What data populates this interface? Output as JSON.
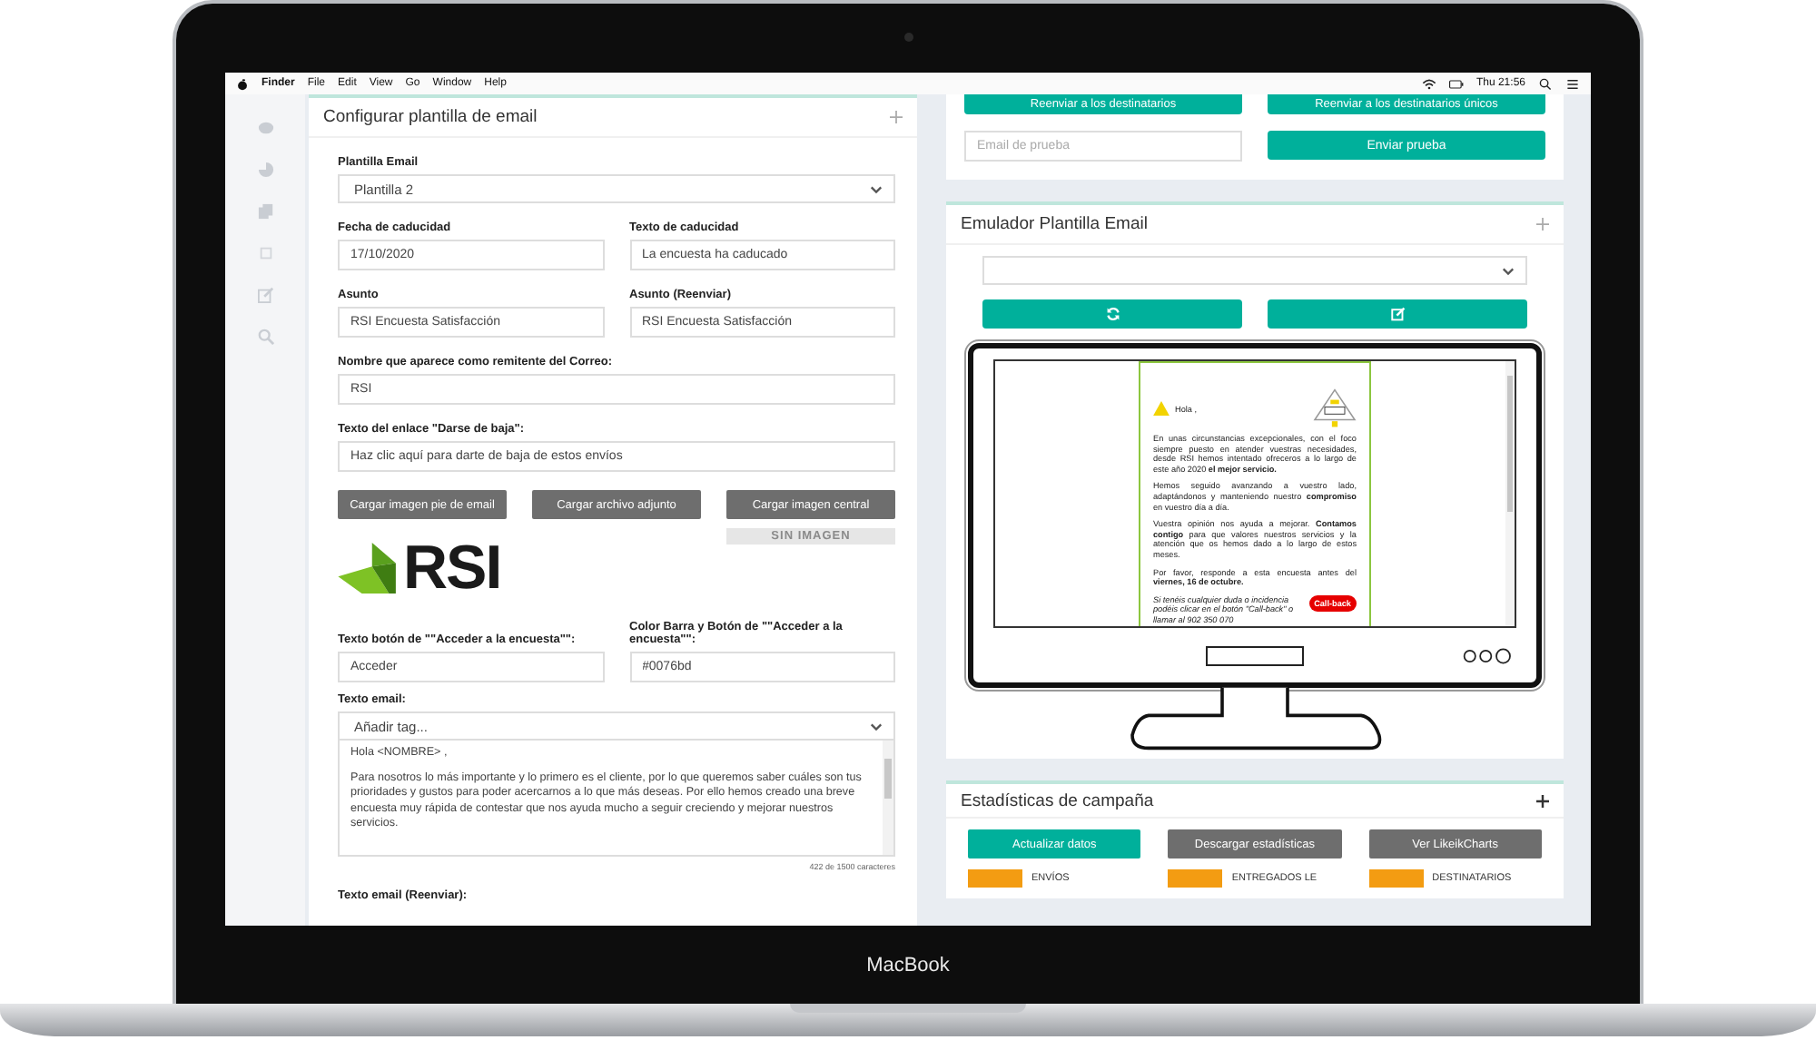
{
  "menu_bar": {
    "app": "Finder",
    "items": [
      "File",
      "Edit",
      "View",
      "Go",
      "Window",
      "Help"
    ],
    "clock": "Thu 21:56"
  },
  "config_panel": {
    "title": "Configurar plantilla de email",
    "template": {
      "label": "Plantilla Email",
      "value": "Plantilla 2"
    },
    "field_rows": [
      [
        {
          "label": "Fecha de caducidad",
          "value": "17/10/2020"
        },
        {
          "label": "Texto de caducidad",
          "value": "La encuesta ha caducado"
        }
      ],
      [
        {
          "label": "Asunto",
          "value": "RSI Encuesta Satisfacción"
        },
        {
          "label": "Asunto (Reenviar)",
          "value": "RSI Encuesta Satisfacción"
        }
      ],
      [
        {
          "label": "Nombre que aparece como remitente del Correo:",
          "value": "RSI"
        }
      ],
      [
        {
          "label": "Texto del enlace \"Darse de baja\":",
          "value": "Haz clic aquí para darte de baja de estos envíos"
        }
      ]
    ],
    "upload_buttons": [
      "Cargar imagen pie de email",
      "Cargar archivo adjunto",
      "Cargar imagen central"
    ],
    "no_image": "SIN IMAGEN",
    "logo_text": "RSI",
    "button_fields": [
      {
        "label": "Texto botón de \"\"Acceder a la encuesta\"\":",
        "value": "Acceder"
      },
      {
        "label": "Color Barra y Botón de \"\"Acceder a la encuesta\"\":",
        "value": "#0076bd"
      }
    ],
    "email_text": {
      "label": "Texto email:",
      "tag_select": "Añadir tag...",
      "paragraphs": [
        "Hola <NOMBRE> ,",
        "Para nosotros lo más importante y lo primero es el cliente, por lo que queremos saber cuáles son tus prioridades y gustos para poder acercarnos a lo que más deseas. Por ello hemos creado una breve encuesta muy rápida de contestar que nos ayuda mucho a seguir creciendo y mejorar nuestros servicios."
      ],
      "counter": "422 de 1500 caracteres"
    },
    "next_label": "Texto email (Reenviar):"
  },
  "send_panel": {
    "buttons": [
      "Reenviar a los destinatarios",
      "Reenviar a los destinatarios únicos"
    ],
    "test_email": {
      "placeholder": "Email de prueba"
    },
    "send_button": "Enviar prueba"
  },
  "emulator_panel": {
    "title": "Emulador Plantilla Email",
    "preview": {
      "greeting": "Hola ,",
      "paragraphs": [
        "En unas circunstancias excepcionales, con el foco siempre puesto en atender vuestras necesidades, desde RSI hemos intentado ofreceros a lo largo de este año 2020 **el mejor servicio.**",
        "Hemos seguido avanzando a vuestro lado, adaptándonos y manteniendo nuestro **compromiso** en vuestro día a día.",
        "Vuestra opinión nos ayuda a mejorar. **Contamos contigo** para que valores nuestros servicios y la atención que os hemos dado a lo largo de estos meses.",
        "Por favor, responde a esta encuesta antes del **viernes, 16 de octubre.**"
      ],
      "footer": "Si tenéis cualquier duda o incidencia podéis clicar en el botón \"Call-back\" o llamar al 902 350 070",
      "callback_button": "Call-back"
    }
  },
  "stats_panel": {
    "title": "Estadísticas de campaña",
    "buttons": [
      {
        "label": "Actualizar datos",
        "kind": "primary"
      },
      {
        "label": "Descargar estadísticas",
        "kind": "secondary"
      },
      {
        "label": "Ver LikeikCharts",
        "kind": "secondary"
      }
    ],
    "cards": [
      "ENVÍOS",
      "ENTREGADOS LE",
      "DESTINATARIOS"
    ]
  },
  "device_label": "MacBook"
}
